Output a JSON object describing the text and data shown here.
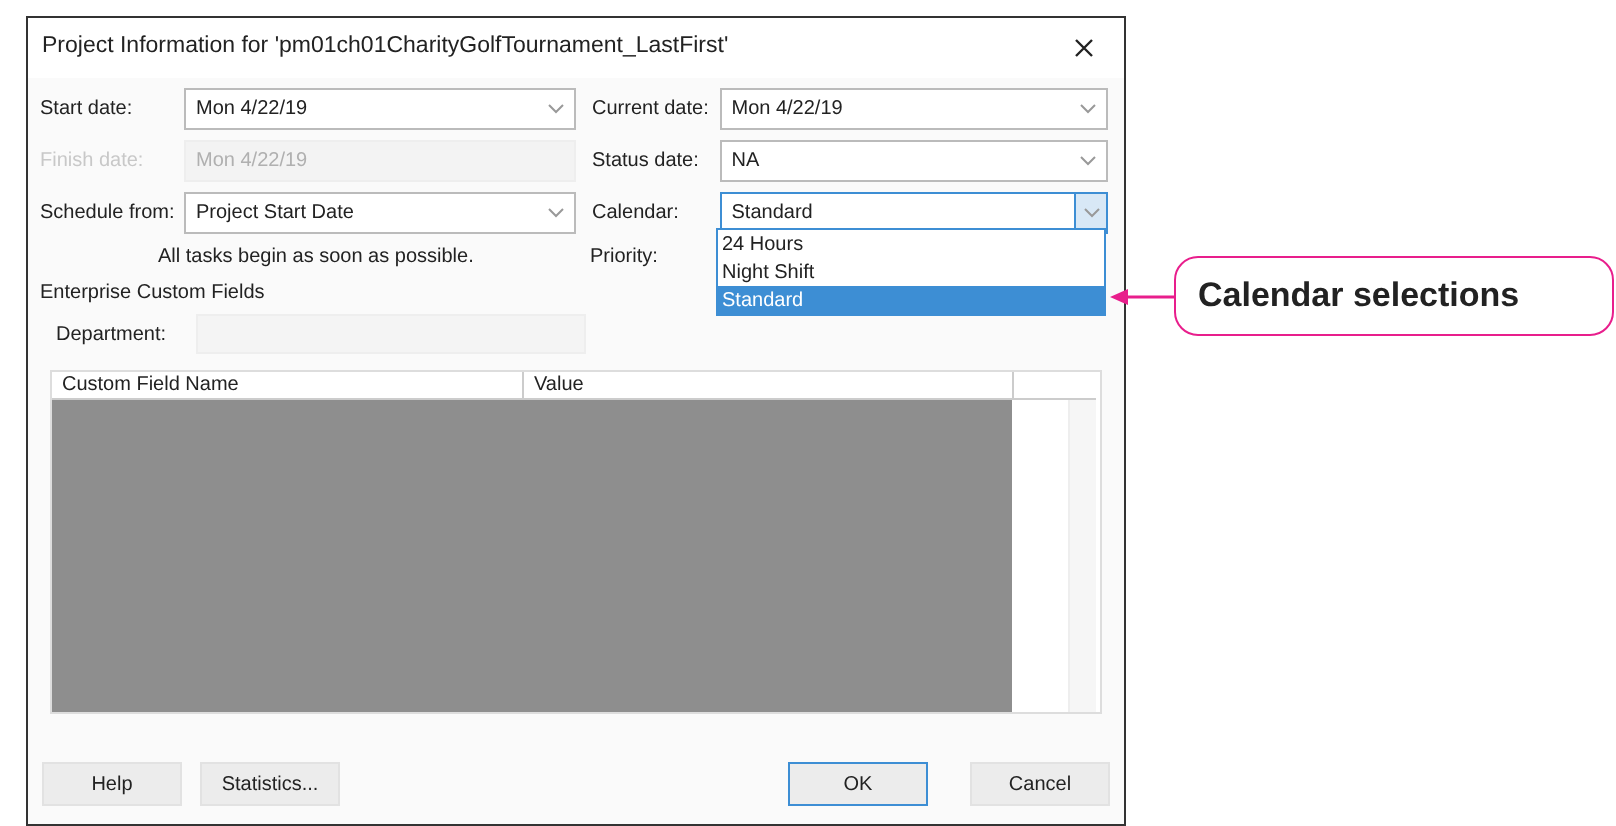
{
  "dialog": {
    "title": "Project Information for 'pm01ch01CharityGolfTournament_LastFirst'",
    "fields_left": [
      {
        "label": "Start date:",
        "value": "Mon 4/22/19",
        "disabled": false
      },
      {
        "label": "Finish date:",
        "value": "Mon 4/22/19",
        "disabled": true
      },
      {
        "label": "Schedule from:",
        "value": "Project Start Date",
        "disabled": false
      }
    ],
    "fields_right": [
      {
        "label": "Current date:",
        "value": "Mon 4/22/19",
        "open": false
      },
      {
        "label": "Status date:",
        "value": "NA",
        "open": false
      },
      {
        "label": "Calendar:",
        "value": "Standard",
        "open": true
      }
    ],
    "schedule_note": "All tasks begin as soon as possible.",
    "priority_label": "Priority:",
    "section_title": "Enterprise Custom Fields",
    "department_label": "Department:",
    "table": {
      "columns": [
        "Custom Field Name",
        "Value"
      ]
    },
    "calendar_options": [
      {
        "label": "24 Hours",
        "selected": false
      },
      {
        "label": "Night Shift",
        "selected": false
      },
      {
        "label": "Standard",
        "selected": true
      }
    ],
    "buttons": [
      {
        "label": "Help",
        "default": false
      },
      {
        "label": "Statistics...",
        "default": false
      },
      {
        "label": "OK",
        "default": true
      },
      {
        "label": "Cancel",
        "default": false
      }
    ]
  },
  "callout": {
    "text": "Calendar selections"
  }
}
